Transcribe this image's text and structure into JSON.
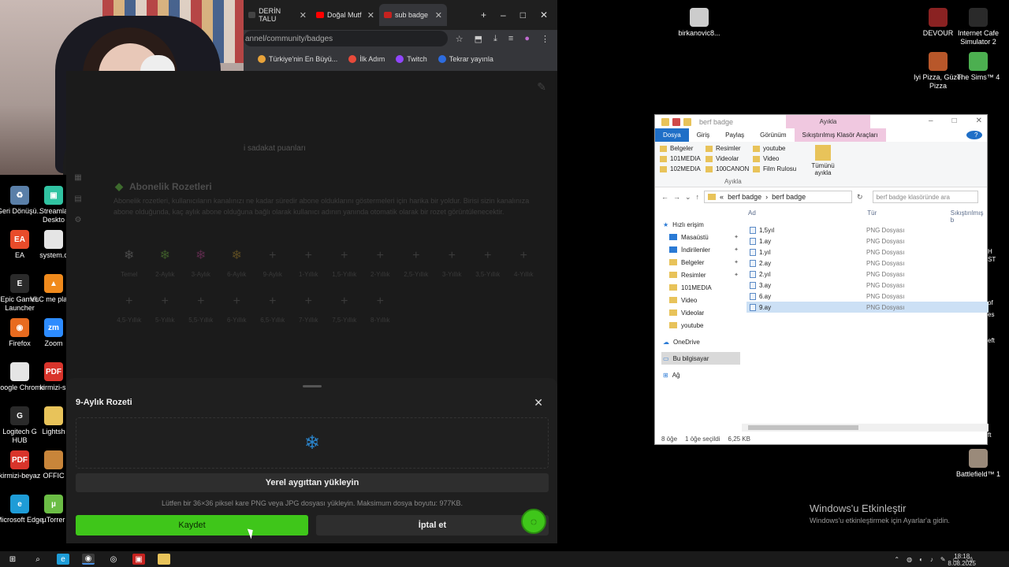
{
  "desktop_left": [
    {
      "label": "Geri Dönüşü...",
      "icon": "recycle-bin-icon",
      "color": "#5a7fa8",
      "glyph": "♻"
    },
    {
      "label": "Streamla Deskto",
      "icon": "streamlabs-icon",
      "color": "#31c3a2",
      "glyph": "▣"
    },
    {
      "label": "EA",
      "icon": "ea-icon",
      "color": "#e84b2a",
      "glyph": "EA"
    },
    {
      "label": "system.c",
      "icon": "file-icon",
      "color": "#e5e5e5",
      "glyph": ""
    },
    {
      "label": "Epic Games Launcher",
      "icon": "epic-games-icon",
      "color": "#2a2a2a",
      "glyph": "E"
    },
    {
      "label": "VLC me player",
      "icon": "vlc-icon",
      "color": "#f08a1c",
      "glyph": "▲"
    },
    {
      "label": "Firefox",
      "icon": "firefox-icon",
      "color": "#e86b1f",
      "glyph": "◉"
    },
    {
      "label": "Zoom",
      "icon": "zoom-icon",
      "color": "#2d8cff",
      "glyph": "zm"
    },
    {
      "label": "Google Chrome",
      "icon": "file-icon",
      "color": "#e5e5e5",
      "glyph": ""
    },
    {
      "label": "kirmizi-si",
      "icon": "pdf-icon",
      "color": "#d9342b",
      "glyph": "PDF"
    },
    {
      "label": "Logitech G HUB",
      "icon": "logitech-icon",
      "color": "#2a2a2a",
      "glyph": "G"
    },
    {
      "label": "Lightsh",
      "icon": "folder-icon",
      "color": "#e8c35a",
      "glyph": ""
    },
    {
      "label": "kirmizi-beyaz",
      "icon": "pdf-icon",
      "color": "#d9342b",
      "glyph": "PDF"
    },
    {
      "label": "OFFIC",
      "icon": "office-icon",
      "color": "#c8853a",
      "glyph": ""
    },
    {
      "label": "Microsoft Edge",
      "icon": "edge-icon",
      "color": "#1e9cd7",
      "glyph": "e"
    },
    {
      "label": "µTorrer",
      "icon": "utorrent-icon",
      "color": "#6bbd45",
      "glyph": "µ"
    }
  ],
  "desktop_right": [
    {
      "label": "birkanovic8...",
      "icon": "file-icon",
      "color": "#cccccc"
    },
    {
      "label": "DEVOUR",
      "icon": "devour-icon",
      "color": "#8a2222"
    },
    {
      "label": "Internet Cafe Simulator 2",
      "icon": "ics2-icon",
      "color": "#2a2a2a"
    },
    {
      "label": "Iyi Pizza, Güzel Pizza",
      "icon": "pizza-icon",
      "color": "#b8572a"
    },
    {
      "label": "The Sims™ 4",
      "icon": "sims-icon",
      "color": "#4caf50"
    },
    {
      "label": "Battlefield™ 1",
      "icon": "battlefield-icon",
      "color": "#9a8a7a"
    }
  ],
  "browser": {
    "tabs": [
      {
        "label": "DERİN TALU",
        "color": "#444444",
        "active": false
      },
      {
        "label": "Doğal Mutf",
        "color": "#ff0000",
        "active": false
      },
      {
        "label": "sub badge",
        "color": "#c5221f",
        "active": true
      }
    ],
    "url": "annel/community/badges",
    "bookmarks": [
      {
        "label": "Türkiye'nin En Büyü...",
        "color": "#e8a33a"
      },
      {
        "label": "İlk Adım",
        "color": "#e84a3a"
      },
      {
        "label": "Twitch",
        "color": "#9146ff"
      },
      {
        "label": "Tekrar yayınla",
        "color": "#2d6cdf"
      }
    ]
  },
  "page": {
    "subtitle_partial": "i sadakat puanları",
    "section_title": "Abonelik Rozetleri",
    "section_desc": "Abonelik rozetleri, kullanıcıların kanalınızı ne kadar süredir abone olduklarını göstermeleri için harika bir yoldur. Birisi sizin kanalınıza abone olduğunda, kaç aylık abone olduğuna bağlı olarak kullanıcı adının yanında otomatik olarak bir rozet görüntülenecektir.",
    "badges": [
      {
        "label": "Temel",
        "glyph": "❄",
        "color": "#4a4a4a"
      },
      {
        "label": "2-Aylık",
        "glyph": "❄",
        "color": "#3d5a2a"
      },
      {
        "label": "3-Aylık",
        "glyph": "❄",
        "color": "#5a2a4a"
      },
      {
        "label": "6-Aylık",
        "glyph": "❄",
        "color": "#5a4a22"
      },
      {
        "label": "9-Aylık",
        "glyph": "+",
        "color": "#3b3b3b"
      },
      {
        "label": "1-Yıllık",
        "glyph": "+",
        "color": "#3b3b3b"
      },
      {
        "label": "1,5-Yıllık",
        "glyph": "+",
        "color": "#3b3b3b"
      },
      {
        "label": "2-Yıllık",
        "glyph": "+",
        "color": "#3b3b3b"
      },
      {
        "label": "2,5-Yıllık",
        "glyph": "+",
        "color": "#3b3b3b"
      },
      {
        "label": "3-Yıllık",
        "glyph": "+",
        "color": "#3b3b3b"
      },
      {
        "label": "3,5-Yıllık",
        "glyph": "+",
        "color": "#3b3b3b"
      },
      {
        "label": "4-Yıllık",
        "glyph": "+",
        "color": "#3b3b3b"
      },
      {
        "label": "4,5-Yıllık",
        "glyph": "+",
        "color": "#3b3b3b"
      },
      {
        "label": "5-Yıllık",
        "glyph": "+",
        "color": "#3b3b3b"
      },
      {
        "label": "5,5-Yıllık",
        "glyph": "+",
        "color": "#3b3b3b"
      },
      {
        "label": "6-Yıllık",
        "glyph": "+",
        "color": "#3b3b3b"
      },
      {
        "label": "6,5-Yıllık",
        "glyph": "+",
        "color": "#3b3b3b"
      },
      {
        "label": "7-Yıllık",
        "glyph": "+",
        "color": "#3b3b3b"
      },
      {
        "label": "7,5-Yıllık",
        "glyph": "+",
        "color": "#3b3b3b"
      },
      {
        "label": "8-Yıllık",
        "glyph": "+",
        "color": "#3b3b3b"
      }
    ]
  },
  "modal": {
    "title": "9-Aylık Rozeti",
    "close_glyph": "✕",
    "preview_glyph": "❄",
    "upload_label": "Yerel aygıttan yükleyin",
    "hint": "Lütfen bir 36×36 piksel kare PNG veya JPG dosyası yükleyin. Maksimum dosya boyutu: 977KB.",
    "save_label": "Kaydet",
    "cancel_label": "İptal et",
    "accent": "#3fc61a"
  },
  "explorer": {
    "title": "berf badge",
    "contextual_tab": "Ayıkla",
    "menu": [
      "Dosya",
      "Giriş",
      "Paylaş",
      "Görünüm"
    ],
    "tools_tab": "Sıkıştırılmış Klasör Araçları",
    "ribbon_items": [
      "Belgeler",
      "Resimler",
      "youtube",
      "101MEDIA",
      "Videolar",
      "Video",
      "102MEDIA",
      "100CANON",
      "Film Rulosu"
    ],
    "ribbon_big": "Tümünü ayıkla",
    "ribbon_group": "Ayıkla",
    "path": [
      "«",
      "berf badge",
      "›",
      "berf badge"
    ],
    "search_placeholder": "berf badge klasöründe ara",
    "columns": [
      "Ad",
      "Tür",
      "Sıkıştırılmış b"
    ],
    "quick_access": "Hızlı erişim",
    "nav": [
      {
        "label": "Masaüstü",
        "pinned": true,
        "blue": true
      },
      {
        "label": "İndirilenler",
        "pinned": true,
        "blue": true
      },
      {
        "label": "Belgeler",
        "pinned": true,
        "blue": false
      },
      {
        "label": "Resimler",
        "pinned": true,
        "blue": false
      },
      {
        "label": "101MEDIA",
        "pinned": false,
        "blue": false
      },
      {
        "label": "Video",
        "pinned": false,
        "blue": false
      },
      {
        "label": "Videolar",
        "pinned": false,
        "blue": false
      },
      {
        "label": "youtube",
        "pinned": false,
        "blue": false
      }
    ],
    "onedrive": "OneDrive",
    "this_pc": "Bu bilgisayar",
    "network": "Ağ",
    "files": [
      {
        "name": "1,5yıl",
        "type": "PNG Dosyası"
      },
      {
        "name": "1.ay",
        "type": "PNG Dosyası"
      },
      {
        "name": "1.yıl",
        "type": "PNG Dosyası"
      },
      {
        "name": "2.ay",
        "type": "PNG Dosyası"
      },
      {
        "name": "2.yıl",
        "type": "PNG Dosyası"
      },
      {
        "name": "3.ay",
        "type": "PNG Dosyası"
      },
      {
        "name": "6.ay",
        "type": "PNG Dosyası"
      },
      {
        "name": "9.ay",
        "type": "PNG Dosyası",
        "selected": true
      }
    ],
    "status_count": "8 öğe",
    "status_selected": "1 öğe seçildi",
    "status_size": "6,25 KB"
  },
  "activation": {
    "title": "Windows'u Etkinleştir",
    "subtitle": "Windows'u etkinleştirmek için Ayarlar'a gidin."
  },
  "edge_fragments": [
    "H",
    "ST",
    "of",
    "es",
    "eft",
    "ft"
  ],
  "taskbar": {
    "time": "18:18",
    "date": "8.08.2025"
  }
}
